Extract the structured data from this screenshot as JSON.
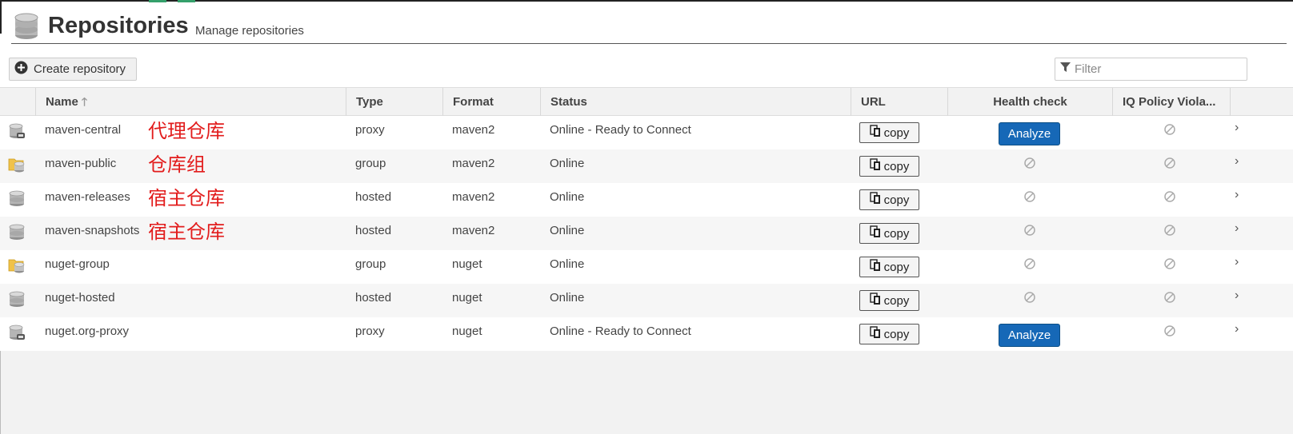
{
  "page": {
    "title": "Repositories",
    "subtitle": "Manage repositories",
    "create_label": "Create repository",
    "filter_placeholder": "Filter"
  },
  "columns": [
    {
      "label": "Name"
    },
    {
      "label": "Type"
    },
    {
      "label": "Format"
    },
    {
      "label": "Status"
    },
    {
      "label": "URL"
    },
    {
      "label": "Health check"
    },
    {
      "label": "IQ Policy Viola..."
    }
  ],
  "rows": [
    {
      "name": "maven-central",
      "note": "代理仓库",
      "type": "proxy",
      "format": "maven2",
      "status": "Online - Ready to Connect",
      "url_label": "copy",
      "health": "Analyze",
      "icon": "proxy-repo-icon"
    },
    {
      "name": "maven-public",
      "note": "仓库组",
      "type": "group",
      "format": "maven2",
      "status": "Online",
      "url_label": "copy",
      "health": "",
      "icon": "group-repo-icon"
    },
    {
      "name": "maven-releases",
      "note": "宿主仓库",
      "type": "hosted",
      "format": "maven2",
      "status": "Online",
      "url_label": "copy",
      "health": "",
      "icon": "hosted-repo-icon"
    },
    {
      "name": "maven-snapshots",
      "note": "宿主仓库",
      "type": "hosted",
      "format": "maven2",
      "status": "Online",
      "url_label": "copy",
      "health": "",
      "icon": "hosted-repo-icon"
    },
    {
      "name": "nuget-group",
      "note": "",
      "type": "group",
      "format": "nuget",
      "status": "Online",
      "url_label": "copy",
      "health": "",
      "icon": "group-repo-icon"
    },
    {
      "name": "nuget-hosted",
      "note": "",
      "type": "hosted",
      "format": "nuget",
      "status": "Online",
      "url_label": "copy",
      "health": "",
      "icon": "hosted-repo-icon"
    },
    {
      "name": "nuget.org-proxy",
      "note": "",
      "type": "proxy",
      "format": "nuget",
      "status": "Online - Ready to Connect",
      "url_label": "copy",
      "health": "Analyze",
      "icon": "proxy-repo-icon"
    }
  ],
  "colors": {
    "accent": "#1668b7",
    "annotation": "#e21c1c"
  }
}
